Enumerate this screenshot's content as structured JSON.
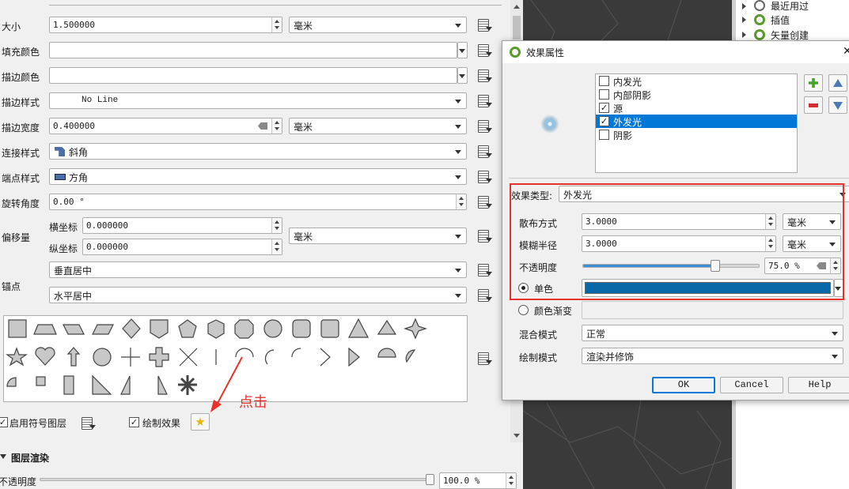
{
  "props": {
    "size_label": "大小",
    "size_value": "1.500000",
    "size_unit": "毫米",
    "fill_color_label": "填充颜色",
    "stroke_color_label": "描边颜色",
    "stroke_style_label": "描边样式",
    "stroke_style_value": "No Line",
    "stroke_width_label": "描边宽度",
    "stroke_width_value": "0.400000",
    "stroke_width_unit": "毫米",
    "join_style_label": "连接样式",
    "join_style_value": "斜角",
    "cap_style_label": "端点样式",
    "cap_style_value": "方角",
    "rotation_label": "旋转角度",
    "rotation_value": "0.00 °",
    "offset_label": "偏移量",
    "offset_x_label": "横坐标",
    "offset_x_value": "0.000000",
    "offset_y_label": "纵坐标",
    "offset_y_value": "0.000000",
    "offset_unit": "毫米",
    "anchor_label": "锚点",
    "anchor_v_value": "垂直居中",
    "anchor_h_value": "水平居中",
    "enable_layer_label": "启用符号图层",
    "draw_effects_label": "绘制效果",
    "layer_render_label": "图层渲染",
    "opacity_label": "不透明度",
    "opacity_value": "100.0 %"
  },
  "annotation": {
    "text": "点击",
    "color": "#e8322b"
  },
  "right_tree": {
    "items": [
      "最近用过",
      "插值",
      "矢量创建"
    ]
  },
  "dialog": {
    "title": "效果属性",
    "effects": [
      {
        "label": "内发光",
        "checked": false,
        "selected": false
      },
      {
        "label": "内部阴影",
        "checked": false,
        "selected": false
      },
      {
        "label": "源",
        "checked": true,
        "selected": false
      },
      {
        "label": "外发光",
        "checked": true,
        "selected": true
      },
      {
        "label": "阴影",
        "checked": false,
        "selected": false
      }
    ],
    "type_label": "效果类型:",
    "type_value": "外发光",
    "spread_label": "散布方式",
    "spread_value": "3.0000",
    "spread_unit": "毫米",
    "blur_label": "模糊半径",
    "blur_value": "3.0000",
    "blur_unit": "毫米",
    "opacity_label": "不透明度",
    "opacity_value": "75.0 %",
    "opacity_fraction": 0.75,
    "single_color_label": "单色",
    "single_color": "#0868a8",
    "gradient_label": "颜色渐变",
    "blend_label": "混合模式",
    "blend_value": "正常",
    "draw_mode_label": "绘制模式",
    "draw_mode_value": "渲染并修饰",
    "ok": "OK",
    "cancel": "Cancel",
    "help": "Help"
  },
  "colors": {
    "highlight": "#e8322b",
    "selection": "#0078d7",
    "map_bg": "#3a3a3a"
  }
}
